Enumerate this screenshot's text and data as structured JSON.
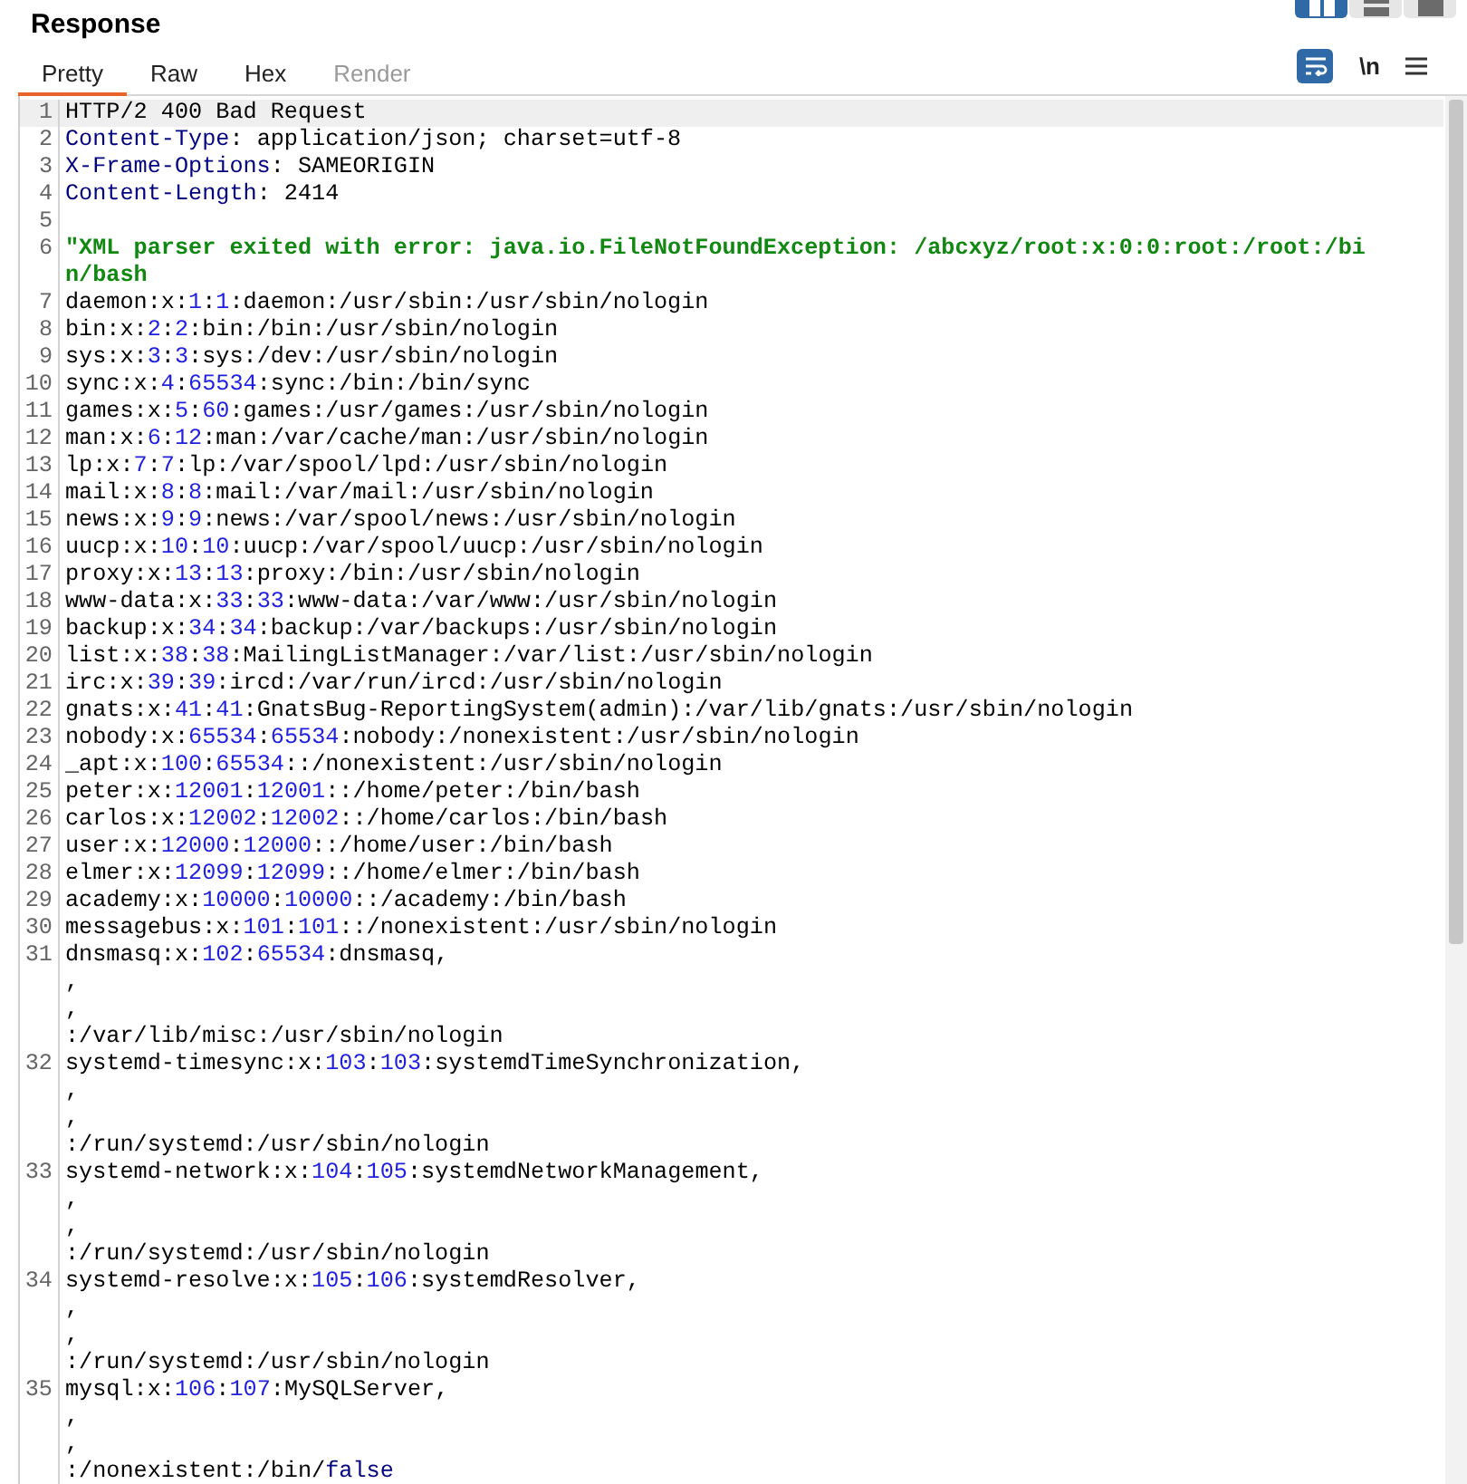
{
  "panel": {
    "title": "Response"
  },
  "view_buttons": [
    {
      "kind": "split",
      "selected": true
    },
    {
      "kind": "horizontal",
      "selected": false
    },
    {
      "kind": "single",
      "selected": false
    }
  ],
  "tabs": [
    {
      "label": "Pretty",
      "selected": true,
      "disabled": false
    },
    {
      "label": "Raw",
      "selected": false,
      "disabled": false
    },
    {
      "label": "Hex",
      "selected": false,
      "disabled": false
    },
    {
      "label": "Render",
      "selected": false,
      "disabled": true
    }
  ],
  "toolbar": {
    "wrap_lines": {
      "on": true
    },
    "newline_toggle": {
      "label": "\\n",
      "on": false
    }
  },
  "lines": [
    {
      "number": "1",
      "highlighted": true,
      "segments": [
        {
          "kind": "plain",
          "text": "HTTP/2 400 Bad Request"
        }
      ]
    },
    {
      "number": "2",
      "highlighted": false,
      "segments": [
        {
          "kind": "key",
          "text": "Content-Type"
        },
        {
          "kind": "plain",
          "text": ": application/json; charset=utf-8"
        }
      ]
    },
    {
      "number": "3",
      "highlighted": false,
      "segments": [
        {
          "kind": "key",
          "text": "X-Frame-Options"
        },
        {
          "kind": "plain",
          "text": ": SAMEORIGIN"
        }
      ]
    },
    {
      "number": "4",
      "highlighted": false,
      "segments": [
        {
          "kind": "key",
          "text": "Content-Length"
        },
        {
          "kind": "plain",
          "text": ": 2414"
        }
      ]
    },
    {
      "number": "5",
      "highlighted": false
    },
    {
      "number": "6",
      "highlighted": false,
      "segments": [
        {
          "kind": "string",
          "text": "\"XML parser exited with error: java.io.FileNotFoundException: /abcxyz/root:x:0:0:root:/root:/bin/bash"
        }
      ]
    },
    {
      "number": "7",
      "highlighted": false,
      "segments": [
        {
          "kind": "plain",
          "text": "daemon:x:"
        },
        {
          "kind": "number",
          "text": "1"
        },
        {
          "kind": "plain",
          "text": ":"
        },
        {
          "kind": "number",
          "text": "1"
        },
        {
          "kind": "plain",
          "text": ":daemon:/usr/sbin:/usr/sbin/nologin"
        }
      ]
    },
    {
      "number": "8",
      "highlighted": false,
      "segments": [
        {
          "kind": "plain",
          "text": "bin:x:"
        },
        {
          "kind": "number",
          "text": "2"
        },
        {
          "kind": "plain",
          "text": ":"
        },
        {
          "kind": "number",
          "text": "2"
        },
        {
          "kind": "plain",
          "text": ":bin:/bin:/usr/sbin/nologin"
        }
      ]
    },
    {
      "number": "9",
      "highlighted": false,
      "segments": [
        {
          "kind": "plain",
          "text": "sys:x:"
        },
        {
          "kind": "number",
          "text": "3"
        },
        {
          "kind": "plain",
          "text": ":"
        },
        {
          "kind": "number",
          "text": "3"
        },
        {
          "kind": "plain",
          "text": ":sys:/dev:/usr/sbin/nologin"
        }
      ]
    },
    {
      "number": "10",
      "highlighted": false,
      "segments": [
        {
          "kind": "plain",
          "text": "sync:x:"
        },
        {
          "kind": "number",
          "text": "4"
        },
        {
          "kind": "plain",
          "text": ":"
        },
        {
          "kind": "number",
          "text": "65534"
        },
        {
          "kind": "plain",
          "text": ":sync:/bin:/bin/sync"
        }
      ]
    },
    {
      "number": "11",
      "highlighted": false,
      "segments": [
        {
          "kind": "plain",
          "text": "games:x:"
        },
        {
          "kind": "number",
          "text": "5"
        },
        {
          "kind": "plain",
          "text": ":"
        },
        {
          "kind": "number",
          "text": "60"
        },
        {
          "kind": "plain",
          "text": ":games:/usr/games:/usr/sbin/nologin"
        }
      ]
    },
    {
      "number": "12",
      "highlighted": false,
      "segments": [
        {
          "kind": "plain",
          "text": "man:x:"
        },
        {
          "kind": "number",
          "text": "6"
        },
        {
          "kind": "plain",
          "text": ":"
        },
        {
          "kind": "number",
          "text": "12"
        },
        {
          "kind": "plain",
          "text": ":man:/var/cache/man:/usr/sbin/nologin"
        }
      ]
    },
    {
      "number": "13",
      "highlighted": false,
      "segments": [
        {
          "kind": "plain",
          "text": "lp:x:"
        },
        {
          "kind": "number",
          "text": "7"
        },
        {
          "kind": "plain",
          "text": ":"
        },
        {
          "kind": "number",
          "text": "7"
        },
        {
          "kind": "plain",
          "text": ":lp:/var/spool/lpd:/usr/sbin/nologin"
        }
      ]
    },
    {
      "number": "14",
      "highlighted": false,
      "segments": [
        {
          "kind": "plain",
          "text": "mail:x:"
        },
        {
          "kind": "number",
          "text": "8"
        },
        {
          "kind": "plain",
          "text": ":"
        },
        {
          "kind": "number",
          "text": "8"
        },
        {
          "kind": "plain",
          "text": ":mail:/var/mail:/usr/sbin/nologin"
        }
      ]
    },
    {
      "number": "15",
      "highlighted": false,
      "segments": [
        {
          "kind": "plain",
          "text": "news:x:"
        },
        {
          "kind": "number",
          "text": "9"
        },
        {
          "kind": "plain",
          "text": ":"
        },
        {
          "kind": "number",
          "text": "9"
        },
        {
          "kind": "plain",
          "text": ":news:/var/spool/news:/usr/sbin/nologin"
        }
      ]
    },
    {
      "number": "16",
      "highlighted": false,
      "segments": [
        {
          "kind": "plain",
          "text": "uucp:x:"
        },
        {
          "kind": "number",
          "text": "10"
        },
        {
          "kind": "plain",
          "text": ":"
        },
        {
          "kind": "number",
          "text": "10"
        },
        {
          "kind": "plain",
          "text": ":uucp:/var/spool/uucp:/usr/sbin/nologin"
        }
      ]
    },
    {
      "number": "17",
      "highlighted": false,
      "segments": [
        {
          "kind": "plain",
          "text": "proxy:x:"
        },
        {
          "kind": "number",
          "text": "13"
        },
        {
          "kind": "plain",
          "text": ":"
        },
        {
          "kind": "number",
          "text": "13"
        },
        {
          "kind": "plain",
          "text": ":proxy:/bin:/usr/sbin/nologin"
        }
      ]
    },
    {
      "number": "18",
      "highlighted": false,
      "segments": [
        {
          "kind": "plain",
          "text": "www-data:x:"
        },
        {
          "kind": "number",
          "text": "33"
        },
        {
          "kind": "plain",
          "text": ":"
        },
        {
          "kind": "number",
          "text": "33"
        },
        {
          "kind": "plain",
          "text": ":www-data:/var/www:/usr/sbin/nologin"
        }
      ]
    },
    {
      "number": "19",
      "highlighted": false,
      "segments": [
        {
          "kind": "plain",
          "text": "backup:x:"
        },
        {
          "kind": "number",
          "text": "34"
        },
        {
          "kind": "plain",
          "text": ":"
        },
        {
          "kind": "number",
          "text": "34"
        },
        {
          "kind": "plain",
          "text": ":backup:/var/backups:/usr/sbin/nologin"
        }
      ]
    },
    {
      "number": "20",
      "highlighted": false,
      "segments": [
        {
          "kind": "plain",
          "text": "list:x:"
        },
        {
          "kind": "number",
          "text": "38"
        },
        {
          "kind": "plain",
          "text": ":"
        },
        {
          "kind": "number",
          "text": "38"
        },
        {
          "kind": "plain",
          "text": ":MailingListManager:/var/list:/usr/sbin/nologin"
        }
      ]
    },
    {
      "number": "21",
      "highlighted": false,
      "segments": [
        {
          "kind": "plain",
          "text": "irc:x:"
        },
        {
          "kind": "number",
          "text": "39"
        },
        {
          "kind": "plain",
          "text": ":"
        },
        {
          "kind": "number",
          "text": "39"
        },
        {
          "kind": "plain",
          "text": ":ircd:/var/run/ircd:/usr/sbin/nologin"
        }
      ]
    },
    {
      "number": "22",
      "highlighted": false,
      "segments": [
        {
          "kind": "plain",
          "text": "gnats:x:"
        },
        {
          "kind": "number",
          "text": "41"
        },
        {
          "kind": "plain",
          "text": ":"
        },
        {
          "kind": "number",
          "text": "41"
        },
        {
          "kind": "plain",
          "text": ":GnatsBug-ReportingSystem(admin):/var/lib/gnats:/usr/sbin/nologin"
        }
      ]
    },
    {
      "number": "23",
      "highlighted": false,
      "segments": [
        {
          "kind": "plain",
          "text": "nobody:x:"
        },
        {
          "kind": "number",
          "text": "65534"
        },
        {
          "kind": "plain",
          "text": ":"
        },
        {
          "kind": "number",
          "text": "65534"
        },
        {
          "kind": "plain",
          "text": ":nobody:/nonexistent:/usr/sbin/nologin"
        }
      ]
    },
    {
      "number": "24",
      "highlighted": false,
      "segments": [
        {
          "kind": "plain",
          "text": "_apt:x:"
        },
        {
          "kind": "number",
          "text": "100"
        },
        {
          "kind": "plain",
          "text": ":"
        },
        {
          "kind": "number",
          "text": "65534"
        },
        {
          "kind": "plain",
          "text": "::/nonexistent:/usr/sbin/nologin"
        }
      ]
    },
    {
      "number": "25",
      "highlighted": false,
      "segments": [
        {
          "kind": "plain",
          "text": "peter:x:"
        },
        {
          "kind": "number",
          "text": "12001"
        },
        {
          "kind": "plain",
          "text": ":"
        },
        {
          "kind": "number",
          "text": "12001"
        },
        {
          "kind": "plain",
          "text": "::/home/peter:/bin/bash"
        }
      ]
    },
    {
      "number": "26",
      "highlighted": false,
      "segments": [
        {
          "kind": "plain",
          "text": "carlos:x:"
        },
        {
          "kind": "number",
          "text": "12002"
        },
        {
          "kind": "plain",
          "text": ":"
        },
        {
          "kind": "number",
          "text": "12002"
        },
        {
          "kind": "plain",
          "text": "::/home/carlos:/bin/bash"
        }
      ]
    },
    {
      "number": "27",
      "highlighted": false,
      "segments": [
        {
          "kind": "plain",
          "text": "user:x:"
        },
        {
          "kind": "number",
          "text": "12000"
        },
        {
          "kind": "plain",
          "text": ":"
        },
        {
          "kind": "number",
          "text": "12000"
        },
        {
          "kind": "plain",
          "text": "::/home/user:/bin/bash"
        }
      ]
    },
    {
      "number": "28",
      "highlighted": false,
      "segments": [
        {
          "kind": "plain",
          "text": "elmer:x:"
        },
        {
          "kind": "number",
          "text": "12099"
        },
        {
          "kind": "plain",
          "text": ":"
        },
        {
          "kind": "number",
          "text": "12099"
        },
        {
          "kind": "plain",
          "text": "::/home/elmer:/bin/bash"
        }
      ]
    },
    {
      "number": "29",
      "highlighted": false,
      "segments": [
        {
          "kind": "plain",
          "text": "academy:x:"
        },
        {
          "kind": "number",
          "text": "10000"
        },
        {
          "kind": "plain",
          "text": ":"
        },
        {
          "kind": "number",
          "text": "10000"
        },
        {
          "kind": "plain",
          "text": "::/academy:/bin/bash"
        }
      ]
    },
    {
      "number": "30",
      "highlighted": false,
      "segments": [
        {
          "kind": "plain",
          "text": "messagebus:x:"
        },
        {
          "kind": "number",
          "text": "101"
        },
        {
          "kind": "plain",
          "text": ":"
        },
        {
          "kind": "number",
          "text": "101"
        },
        {
          "kind": "plain",
          "text": "::/nonexistent:/usr/sbin/nologin"
        }
      ]
    },
    {
      "number": "31",
      "highlighted": false,
      "segments": [
        {
          "kind": "plain",
          "text": "dnsmasq:x:"
        },
        {
          "kind": "number",
          "text": "102"
        },
        {
          "kind": "plain",
          "text": ":"
        },
        {
          "kind": "number",
          "text": "65534"
        },
        {
          "kind": "plain",
          "text": ":dnsmasq,\n,\n,\n:/var/lib/misc:/usr/sbin/nologin"
        }
      ]
    },
    {
      "number": "32",
      "highlighted": false,
      "segments": [
        {
          "kind": "plain",
          "text": "systemd-timesync:x:"
        },
        {
          "kind": "number",
          "text": "103"
        },
        {
          "kind": "plain",
          "text": ":"
        },
        {
          "kind": "number",
          "text": "103"
        },
        {
          "kind": "plain",
          "text": ":systemdTimeSynchronization,\n,\n,\n:/run/systemd:/usr/sbin/nologin"
        }
      ]
    },
    {
      "number": "33",
      "highlighted": false,
      "segments": [
        {
          "kind": "plain",
          "text": "systemd-network:x:"
        },
        {
          "kind": "number",
          "text": "104"
        },
        {
          "kind": "plain",
          "text": ":"
        },
        {
          "kind": "number",
          "text": "105"
        },
        {
          "kind": "plain",
          "text": ":systemdNetworkManagement,\n,\n,\n:/run/systemd:/usr/sbin/nologin"
        }
      ]
    },
    {
      "number": "34",
      "highlighted": false,
      "segments": [
        {
          "kind": "plain",
          "text": "systemd-resolve:x:"
        },
        {
          "kind": "number",
          "text": "105"
        },
        {
          "kind": "plain",
          "text": ":"
        },
        {
          "kind": "number",
          "text": "106"
        },
        {
          "kind": "plain",
          "text": ":systemdResolver,\n,\n,\n:/run/systemd:/usr/sbin/nologin"
        }
      ]
    },
    {
      "number": "35",
      "highlighted": false,
      "segments": [
        {
          "kind": "plain",
          "text": "mysql:x:"
        },
        {
          "kind": "number",
          "text": "106"
        },
        {
          "kind": "plain",
          "text": ":"
        },
        {
          "kind": "number",
          "text": "107"
        },
        {
          "kind": "plain",
          "text": ":MySQLServer,\n,\n,\n:/nonexistent:/bin/"
        },
        {
          "kind": "keyword",
          "text": "false"
        }
      ]
    }
  ]
}
